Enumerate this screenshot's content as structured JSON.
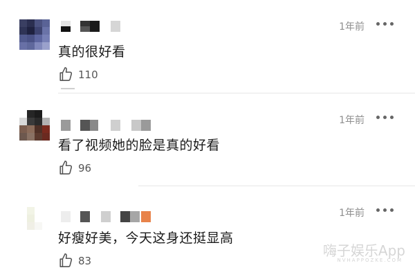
{
  "comments": [
    {
      "time": "1年前",
      "text": "真的很好看",
      "likes": "110"
    },
    {
      "time": "1年前",
      "text": "看了视频她的脸是真的好看",
      "likes": "96"
    },
    {
      "time": "1年前",
      "text": "好瘦好美，今天这身还挺显高",
      "likes": "83"
    }
  ],
  "watermark": {
    "main": "嗨子娱乐App",
    "sub": "NVHAPPOZKE.COM"
  },
  "icons": {
    "like": "thumbs-up-icon",
    "more": "more-dots-icon"
  },
  "colors": {
    "text": "#1a1a1a",
    "meta": "#8e8e8e",
    "divider": "#e6e6e6",
    "name_accent": "#e8834a"
  }
}
